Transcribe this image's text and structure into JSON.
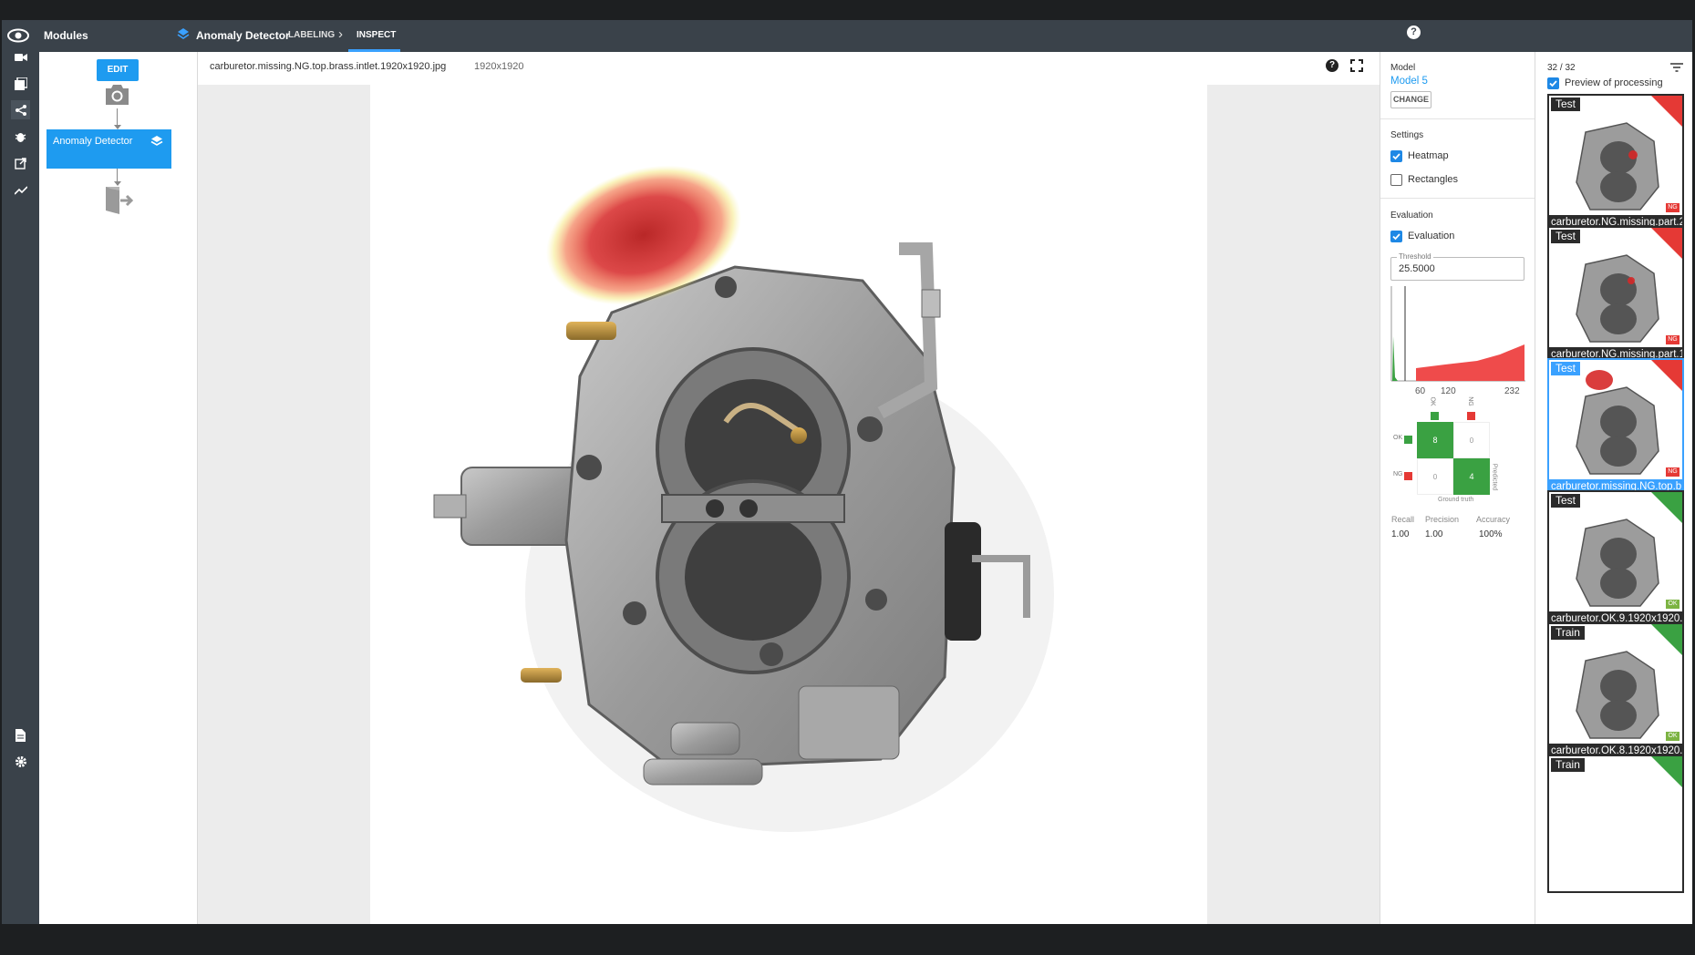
{
  "topbar": {
    "modules_label": "Modules",
    "app_title": "Anomaly Detector",
    "tab_labeling": "LABELING",
    "tab_inspect": "INSPECT",
    "help": "?"
  },
  "modules": {
    "edit_label": "EDIT",
    "node_label": "Anomaly Detector"
  },
  "viewer": {
    "filename": "carburetor.missing.NG.top.brass.intlet.1920x1920.jpg",
    "dimensions": "1920x1920"
  },
  "model": {
    "section": "Model",
    "name": "Model 5",
    "change_label": "CHANGE"
  },
  "settings": {
    "section": "Settings",
    "heatmap_label": "Heatmap",
    "heatmap_checked": true,
    "rectangles_label": "Rectangles",
    "rectangles_checked": false
  },
  "evaluation": {
    "section": "Evaluation",
    "evaluation_label": "Evaluation",
    "evaluation_checked": true,
    "threshold_label": "Threshold",
    "threshold_value": "25.5000",
    "histogram_ticks": [
      "60",
      "120",
      "232"
    ],
    "confusion": {
      "col_ok": "OK",
      "col_ng": "NG",
      "row_ok": "OK",
      "row_ng": "NG",
      "tp": "8",
      "fp": "0",
      "fn": "0",
      "tn": "4",
      "predicted_label": "Predicted",
      "ground_truth_label": "Ground truth"
    },
    "metrics": {
      "recall_label": "Recall",
      "recall_value": "1.00",
      "precision_label": "Precision",
      "precision_value": "1.00",
      "accuracy_label": "Accuracy",
      "accuracy_value": "100%"
    }
  },
  "thumbs": {
    "count": "32 / 32",
    "preview_label": "Preview of processing",
    "preview_checked": true,
    "items": [
      {
        "tag": "Test",
        "caption": "carburetor.NG.missing.part.2",
        "badge": "NG"
      },
      {
        "tag": "Test",
        "caption": "carburetor.NG.missing.part.1",
        "badge": "NG"
      },
      {
        "tag": "Test",
        "caption": "carburetor.missing.NG.top.b",
        "badge": "NG"
      },
      {
        "tag": "Test",
        "caption": "carburetor.OK.9.1920x1920.",
        "badge": "OK"
      },
      {
        "tag": "Train",
        "caption": "carburetor.OK.8.1920x1920.",
        "badge": "OK"
      },
      {
        "tag": "Train",
        "caption": "",
        "badge": ""
      }
    ]
  },
  "colors": {
    "accent": "#1e88e5",
    "ok_green": "#3aa142",
    "ng_red": "#e53935",
    "topbar": "#3a424a"
  }
}
